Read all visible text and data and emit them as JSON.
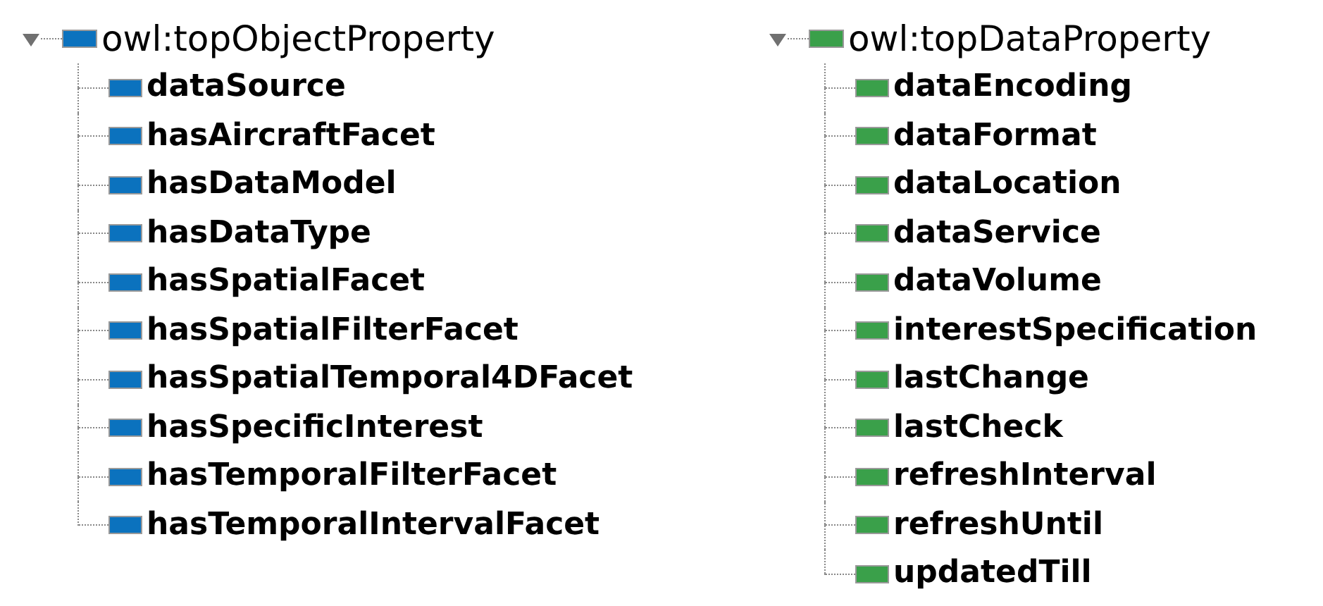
{
  "trees": [
    {
      "label": "owl:topObjectProperty",
      "expanded": true,
      "color": "#0b72be",
      "children": [
        {
          "label": "dataSource"
        },
        {
          "label": "hasAircraftFacet"
        },
        {
          "label": "hasDataModel"
        },
        {
          "label": "hasDataType"
        },
        {
          "label": "hasSpatialFacet"
        },
        {
          "label": "hasSpatialFilterFacet"
        },
        {
          "label": "hasSpatialTemporal4DFacet"
        },
        {
          "label": "hasSpecificInterest"
        },
        {
          "label": "hasTemporalFilterFacet"
        },
        {
          "label": "hasTemporalIntervalFacet"
        }
      ]
    },
    {
      "label": "owl:topDataProperty",
      "expanded": true,
      "color": "#3aa04a",
      "children": [
        {
          "label": "dataEncoding"
        },
        {
          "label": "dataFormat"
        },
        {
          "label": "dataLocation"
        },
        {
          "label": "dataService"
        },
        {
          "label": "dataVolume"
        },
        {
          "label": "interestSpecification"
        },
        {
          "label": "lastChange"
        },
        {
          "label": "lastCheck"
        },
        {
          "label": "refreshInterval"
        },
        {
          "label": "refreshUntil"
        },
        {
          "label": "updatedTill"
        }
      ]
    }
  ]
}
